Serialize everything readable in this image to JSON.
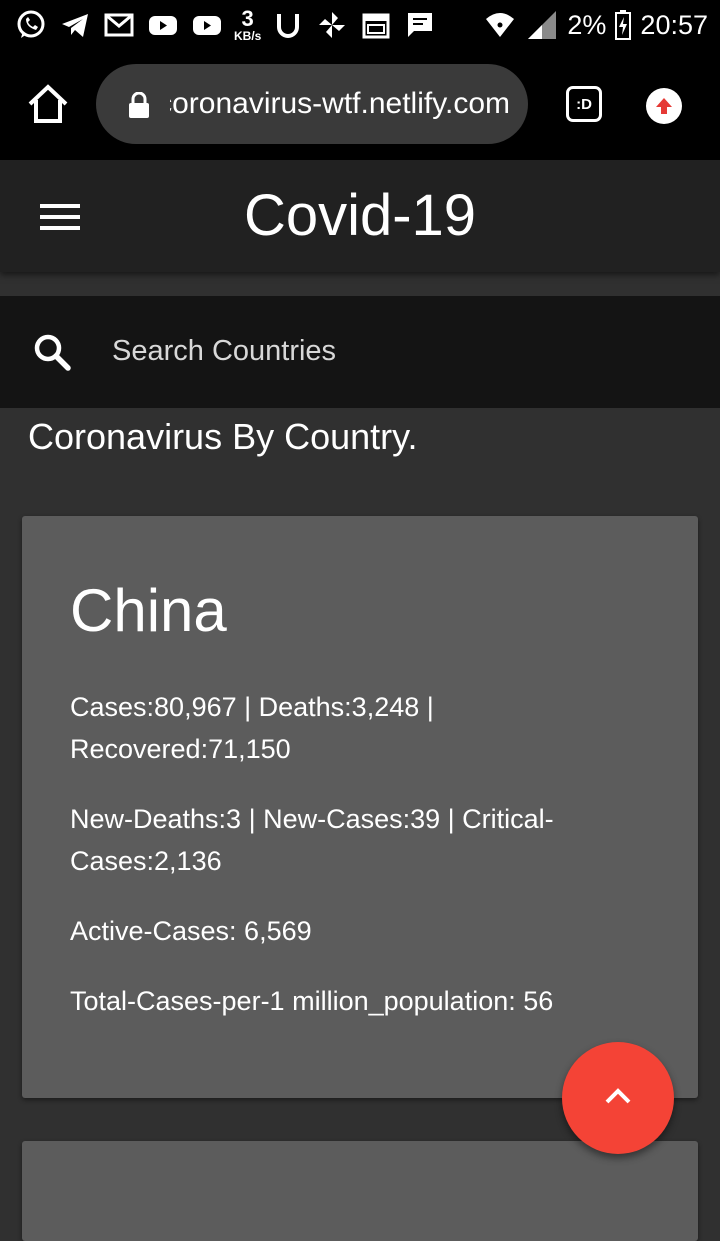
{
  "status_bar": {
    "net_speed_value": "3",
    "net_speed_unit": "KB/s",
    "battery": "2%",
    "time": "20:57"
  },
  "browser": {
    "url": "coronavirus-wtf.netlify.com",
    "extension_label": ":D"
  },
  "app_bar": {
    "title": "Covid-19"
  },
  "search": {
    "placeholder": "Search Countries"
  },
  "section_heading": "Coronavirus By Country.",
  "cards": [
    {
      "country": "China",
      "lines": [
        "Cases:80,967 | Deaths:3,248 | Recovered:71,150",
        "New-Deaths:3 | New-Cases:39 | Critical-Cases:2,136",
        "Active-Cases: 6,569",
        "Total-Cases-per-1 million_population: 56"
      ]
    }
  ],
  "colors": {
    "background": "#303030",
    "app_bar": "#212121",
    "search_bar": "#141414",
    "card": "#5c5c5c",
    "fab": "#f44336"
  },
  "icons": {
    "status_bar": [
      "whatsapp-icon",
      "telegram-icon",
      "gmail-icon",
      "youtube-icon",
      "youtube-icon",
      "u-app-icon",
      "pinwheel-icon",
      "calendar-icon",
      "message-icon",
      "wifi-icon",
      "signal-icon",
      "battery-icon"
    ],
    "browser": [
      "home-icon",
      "lock-icon",
      "extension-icon",
      "upload-icon"
    ],
    "app": [
      "menu-icon",
      "search-icon",
      "chevron-up-icon"
    ]
  }
}
